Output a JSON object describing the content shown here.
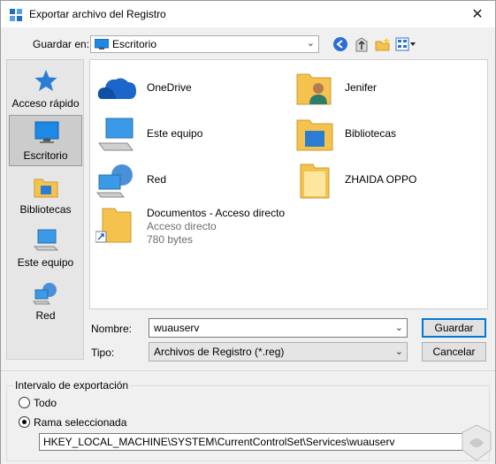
{
  "window": {
    "title": "Exportar archivo del Registro",
    "close_glyph": "✕"
  },
  "toolbar": {
    "save_in_label": "Guardar en:",
    "save_in_value": "Escritorio",
    "icons": [
      "back-icon",
      "up-folder-icon",
      "new-folder-icon",
      "view-menu-icon"
    ]
  },
  "places": [
    {
      "label": "Acceso rápido",
      "icon": "star-icon"
    },
    {
      "label": "Escritorio",
      "icon": "desktop-icon",
      "selected": true
    },
    {
      "label": "Bibliotecas",
      "icon": "libraries-icon"
    },
    {
      "label": "Este equipo",
      "icon": "computer-icon"
    },
    {
      "label": "Red",
      "icon": "network-icon"
    }
  ],
  "files": [
    {
      "name": "OneDrive",
      "icon": "onedrive-icon"
    },
    {
      "name": "Jenifer",
      "icon": "user-folder-icon"
    },
    {
      "name": "Este equipo",
      "icon": "computer-icon"
    },
    {
      "name": "Bibliotecas",
      "icon": "libraries-icon"
    },
    {
      "name": "Red",
      "icon": "network-icon"
    },
    {
      "name": "ZHAIDA OPPO",
      "icon": "folder-icon"
    },
    {
      "name": "Documentos - Acceso directo",
      "sub1": "Acceso directo",
      "sub2": "780 bytes",
      "icon": "shortcut-folder-icon"
    }
  ],
  "form": {
    "name_label": "Nombre:",
    "name_value": "wuauserv",
    "type_label": "Tipo:",
    "type_value": "Archivos de Registro (*.reg)",
    "save_button": "Guardar",
    "cancel_button": "Cancelar"
  },
  "export": {
    "group_title": "Intervalo de exportación",
    "all_label": "Todo",
    "branch_label": "Rama seleccionada",
    "selected_option": "branch",
    "branch_path": "HKEY_LOCAL_MACHINE\\SYSTEM\\CurrentControlSet\\Services\\wuauserv"
  },
  "colors": {
    "accent": "#0078d7",
    "folder": "#f6c24e",
    "list_bg": "#ffffff"
  }
}
